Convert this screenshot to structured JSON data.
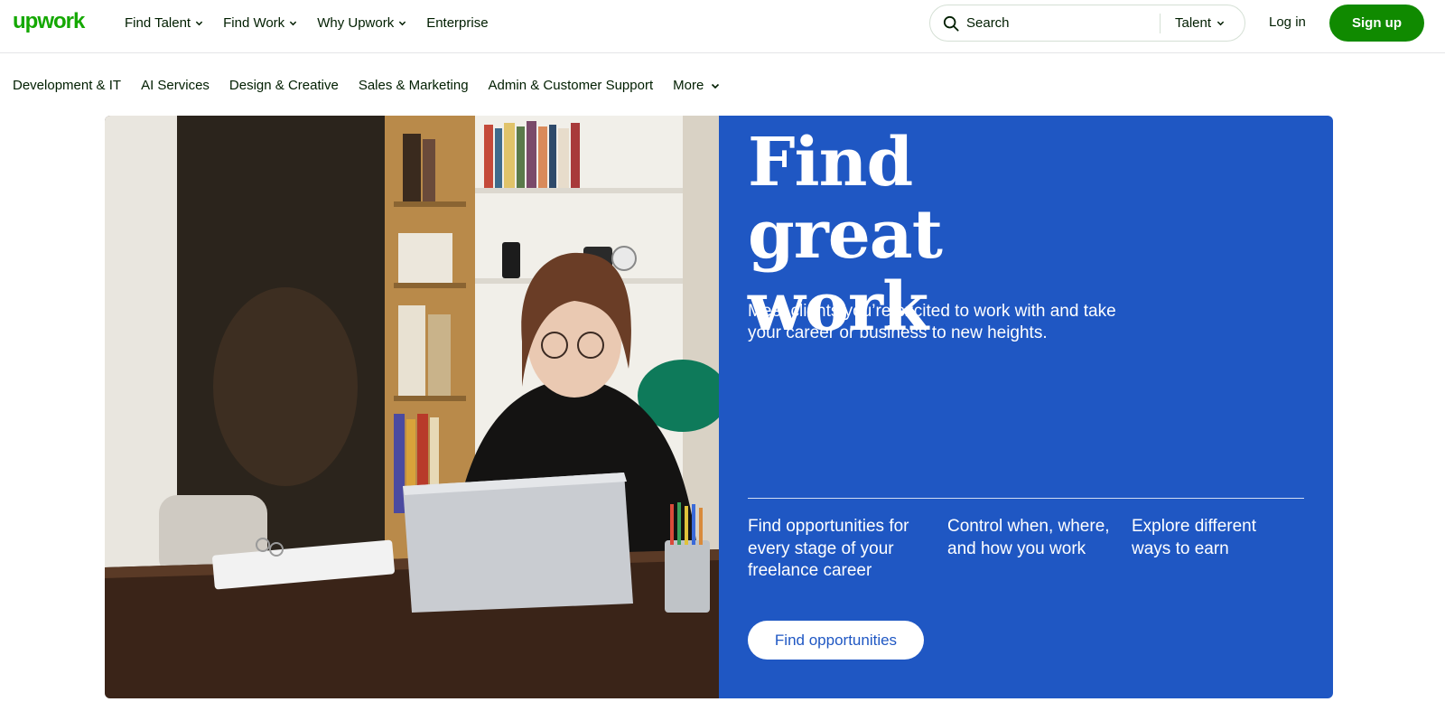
{
  "brand": {
    "logo_text": "upwork",
    "logo_color": "#14a800"
  },
  "nav": {
    "items": [
      {
        "label": "Find Talent",
        "has_dropdown": true
      },
      {
        "label": "Find Work",
        "has_dropdown": true
      },
      {
        "label": "Why Upwork",
        "has_dropdown": true
      },
      {
        "label": "Enterprise",
        "has_dropdown": false
      }
    ]
  },
  "search": {
    "placeholder": "Search",
    "scope": "Talent"
  },
  "auth": {
    "login_label": "Log in",
    "signup_label": "Sign up"
  },
  "categories": [
    {
      "label": "Development & IT"
    },
    {
      "label": "AI Services"
    },
    {
      "label": "Design & Creative"
    },
    {
      "label": "Sales & Marketing"
    },
    {
      "label": "Admin & Customer Support"
    },
    {
      "label": "More"
    }
  ],
  "hero": {
    "title": "Find great work",
    "subtitle": "Meet clients you’re excited to work with and take your career or business to new heights.",
    "features": [
      "Find opportunities for every stage of your freelance career",
      "Control when, where, and how you work",
      "Explore different ways to earn"
    ],
    "cta_label": "Find opportunities",
    "panel_color": "#1f57c3"
  },
  "colors": {
    "accent_green": "#108a00",
    "text": "#001e00",
    "hero_blue": "#1f57c3"
  }
}
